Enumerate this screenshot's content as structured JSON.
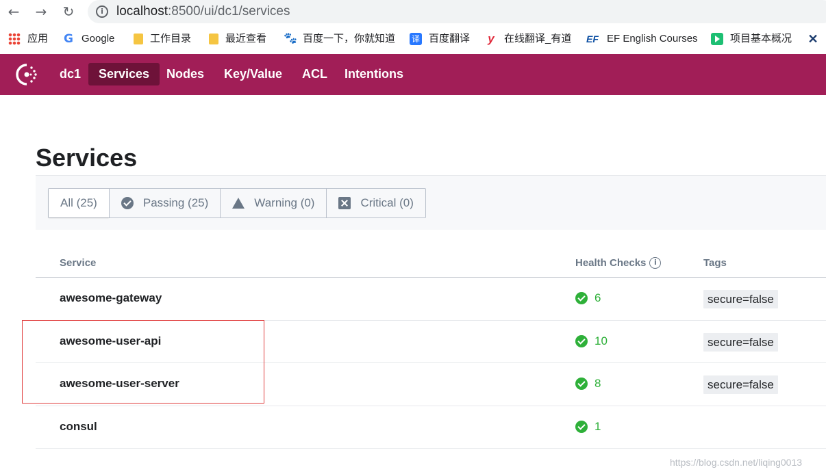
{
  "browser": {
    "url_host": "localhost",
    "url_rest": ":8500/ui/dc1/services",
    "bookmarks": [
      {
        "label": "应用",
        "icon": "apps-grid-icon"
      },
      {
        "label": "Google",
        "icon": "google-icon"
      },
      {
        "label": "工作目录",
        "icon": "folder-icon"
      },
      {
        "label": "最近查看",
        "icon": "folder-icon"
      },
      {
        "label": "百度一下，你就知道",
        "icon": "baidu-paw-icon"
      },
      {
        "label": "百度翻译",
        "icon": "baidu-translate-icon"
      },
      {
        "label": "在线翻译_有道",
        "icon": "youdao-icon"
      },
      {
        "label": "EF English Courses",
        "icon": "ef-icon"
      },
      {
        "label": "项目基本概况",
        "icon": "play-icon"
      },
      {
        "label": "",
        "icon": "x-logo-icon"
      }
    ],
    "bookmark_glyphs": {
      "google": "G",
      "baidu": "🐾",
      "fanyi": "译",
      "youdao": "y",
      "ef": "EF",
      "x": "✕"
    }
  },
  "nav": {
    "datacenter": "dc1",
    "items": [
      "Services",
      "Nodes",
      "Key/Value",
      "ACL",
      "Intentions"
    ],
    "active": "Services",
    "accent": "#a11e57"
  },
  "page": {
    "title": "Services",
    "filters": [
      {
        "label": "All (25)",
        "icon": ""
      },
      {
        "label": "Passing (25)",
        "icon": "passing-check-icon"
      },
      {
        "label": "Warning (0)",
        "icon": "warning-triangle-icon"
      },
      {
        "label": "Critical (0)",
        "icon": "critical-x-icon"
      }
    ],
    "columns": {
      "service": "Service",
      "health": "Health Checks",
      "tags": "Tags"
    },
    "rows": [
      {
        "name": "awesome-gateway",
        "checks": "6",
        "tag": "secure=false"
      },
      {
        "name": "awesome-user-api",
        "checks": "10",
        "tag": "secure=false"
      },
      {
        "name": "awesome-user-server",
        "checks": "8",
        "tag": "secure=false"
      },
      {
        "name": "consul",
        "checks": "1",
        "tag": ""
      }
    ],
    "passing_color": "#2eb039"
  },
  "watermark": "https://blog.csdn.net/liqing0013"
}
